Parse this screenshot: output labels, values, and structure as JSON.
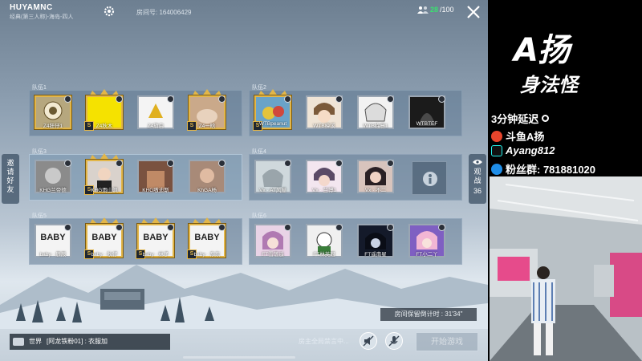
{
  "header": {
    "room_owner": "HUYAMNC",
    "room_mode": "经典(第三人称)-海岛-四人",
    "room_number": "房间号: 164006429",
    "player_count_current": "28",
    "player_count_max": "/100"
  },
  "side": {
    "invite": "邀\n请\n好\n友",
    "watch": "观\n战",
    "watch_count": "36"
  },
  "teams": [
    {
      "label": "队伍1",
      "players": [
        {
          "name": "Z4狂仔1",
          "frame": "gold"
        },
        {
          "name": "Z4秋木",
          "frame": "gold",
          "rank": "S"
        },
        {
          "name": "Z4旗白",
          "frame": "silver"
        },
        {
          "name": "Z4一晗",
          "frame": "gold",
          "rank": "S"
        }
      ]
    },
    {
      "label": "队伍2",
      "players": [
        {
          "name": "WTBpeanut",
          "frame": "gold",
          "rank": "S"
        },
        {
          "name": "WTB樟溪",
          "frame": "silver"
        },
        {
          "name": "WTB临意1",
          "frame": "silver"
        },
        {
          "name": "WTBTEF",
          "frame": "silver"
        }
      ]
    },
    {
      "label": "队伍3",
      "players": [
        {
          "name": "KHG兰帝德",
          "frame": "silver"
        },
        {
          "name": "KHG雨山沨",
          "frame": "gold",
          "rank": "S"
        },
        {
          "name": "KHG嗷迪斯",
          "frame": "silver"
        },
        {
          "name": "KhGA杨",
          "frame": "silver"
        }
      ]
    },
    {
      "label": "队伍4",
      "players": [
        {
          "name": "Vx · AT风屋",
          "frame": "silver"
        },
        {
          "name": "Vx · 兰博1",
          "frame": "silver"
        },
        {
          "name": "Vx · 不二",
          "frame": "silver"
        }
      ]
    },
    {
      "label": "队伍5",
      "players": [
        {
          "name": "baby · 辰辰",
          "frame": "silver",
          "card": "BABY"
        },
        {
          "name": "baby · 秋仔",
          "frame": "gold",
          "card": "BABY",
          "rank": "S"
        },
        {
          "name": "baby · 林子",
          "frame": "gold",
          "card": "BABY",
          "rank": "S"
        },
        {
          "name": "baby · 东东",
          "frame": "gold",
          "card": "BABY",
          "rank": "S"
        }
      ]
    },
    {
      "label": "队伍6",
      "players": [
        {
          "name": "FT雪落遥",
          "frame": "silver"
        },
        {
          "name": "FT林英冠",
          "frame": "silver"
        },
        {
          "name": "FT遥南星",
          "frame": "silver"
        },
        {
          "name": "FT小二丫",
          "frame": "silver"
        }
      ]
    }
  ],
  "countdown": "房间保留倒计时 : 31'34\"",
  "chat": {
    "channel": "世界",
    "message": "[阿龙铁粉01] : 衣服加"
  },
  "host_notice": "房主全局禁言中...",
  "start_button": "开始游戏",
  "streamer": {
    "title": "A扬",
    "subtitle": "身法怪",
    "delay": "3分钟延迟",
    "douyu": "斗鱼A扬",
    "douyin": "Ayang812",
    "fans_group": "粉丝群: 781881020"
  },
  "colors": {
    "gold": "#e2b649",
    "count_green": "#39e36f"
  }
}
